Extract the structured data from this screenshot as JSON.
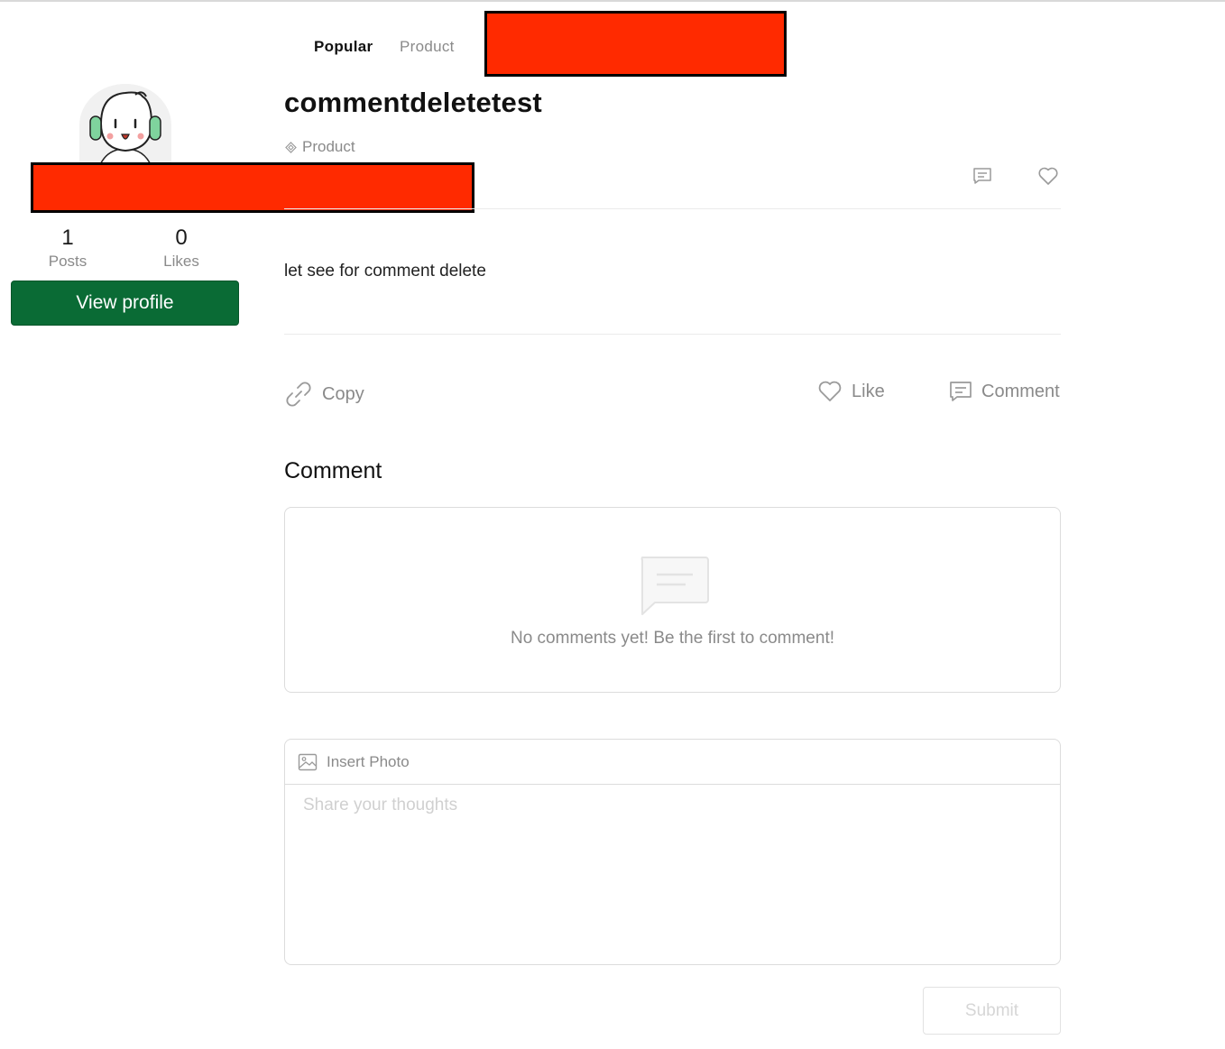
{
  "tabs": [
    {
      "label": "Popular",
      "active": true
    },
    {
      "label": "Product",
      "active": false
    }
  ],
  "profile": {
    "posts_count": "1",
    "posts_label": "Posts",
    "likes_count": "0",
    "likes_label": "Likes",
    "view_profile_label": "View profile"
  },
  "post": {
    "title": "commentdeletetest",
    "category": "Product",
    "body": "let see for comment delete"
  },
  "actions": {
    "copy_label": "Copy",
    "like_label": "Like",
    "comment_label": "Comment"
  },
  "comments": {
    "section_title": "Comment",
    "empty_text": "No comments yet! Be the first to comment!",
    "insert_photo_label": "Insert Photo",
    "input_placeholder": "Share your thoughts",
    "submit_label": "Submit"
  },
  "colors": {
    "accent_green": "#0a6b35",
    "redaction": "#ff2a00"
  },
  "icons": [
    "link-icon",
    "heart-icon",
    "comment-icon",
    "image-icon",
    "category-icon"
  ]
}
